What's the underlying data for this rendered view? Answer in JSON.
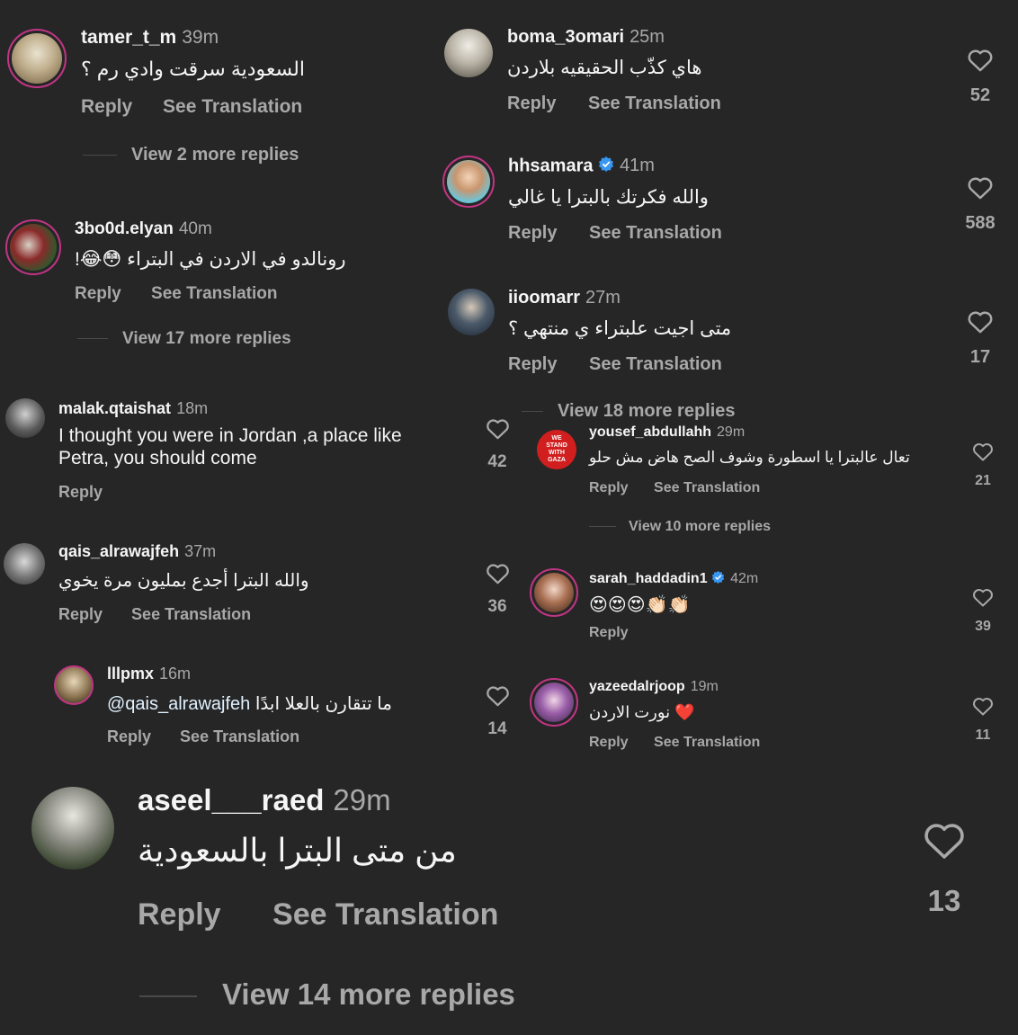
{
  "common": {
    "reply": "Reply",
    "see_translation": "See Translation"
  },
  "colors": {
    "background": "#262626",
    "text": "#f5f5f5",
    "muted": "#a8a8a8",
    "verified": "#3897f0",
    "story_ring": "#c13584"
  },
  "comments": {
    "tamer": {
      "username": "tamer_t_m",
      "time": "39m",
      "text": "السعودية سرقت وادي رم ؟",
      "more": "View 2 more replies"
    },
    "elyan": {
      "username": "3bo0d.elyan",
      "time": "40m",
      "text": "رونالدو في الاردن في البتراء 😳😂!",
      "more": "View 17 more replies"
    },
    "malak": {
      "username": "malak.qtaishat",
      "time": "18m",
      "text_line1": "I thought you were in Jordan ,a place like",
      "text_line2": "Petra, you should come",
      "likes": "42"
    },
    "qais": {
      "username": "qais_alrawajfeh",
      "time": "37m",
      "text": "والله البترا أجدع بمليون مرة يخوي",
      "likes": "36"
    },
    "lllpmx": {
      "username": "lllpmx",
      "time": "16m",
      "mention": "@qais_alrawajfeh",
      "text": "ما تتقارن بالعلا ابدًا",
      "likes": "14"
    },
    "boma": {
      "username": "boma_3omari",
      "time": "25m",
      "text": "هاي كذّب الحقيقيه بلاردن",
      "likes": "52"
    },
    "hhsamara": {
      "username": "hhsamara",
      "time": "41m",
      "text": "والله فكرتك بالبترا يا غالي",
      "likes": "588"
    },
    "iioomarr": {
      "username": "iioomarr",
      "time": "27m",
      "text": "متى اجيت علبتراء  ي منتهي ؟",
      "likes": "17",
      "more": "View 18 more replies"
    },
    "yousef": {
      "username": "yousef_abdullahh",
      "time": "29m",
      "avatar_text": "WE STAND WITH GAZA",
      "text": "تعال عالبترا يا اسطورة وشوف الصح هاض مش حلو",
      "likes": "21",
      "more": "View 10 more replies"
    },
    "sarah": {
      "username": "sarah_haddadin1",
      "time": "42m",
      "text": "😍😍😍👏🏻👏🏻",
      "likes": "39"
    },
    "yazeed": {
      "username": "yazeedalrjoop",
      "time": "19m",
      "text": "❤️ نورت الاردن",
      "likes": "11"
    },
    "aseel": {
      "username": "aseel___raed",
      "time": "29m",
      "text": "من متى البترا بالسعودية",
      "likes": "13",
      "more": "View 14 more replies"
    }
  }
}
